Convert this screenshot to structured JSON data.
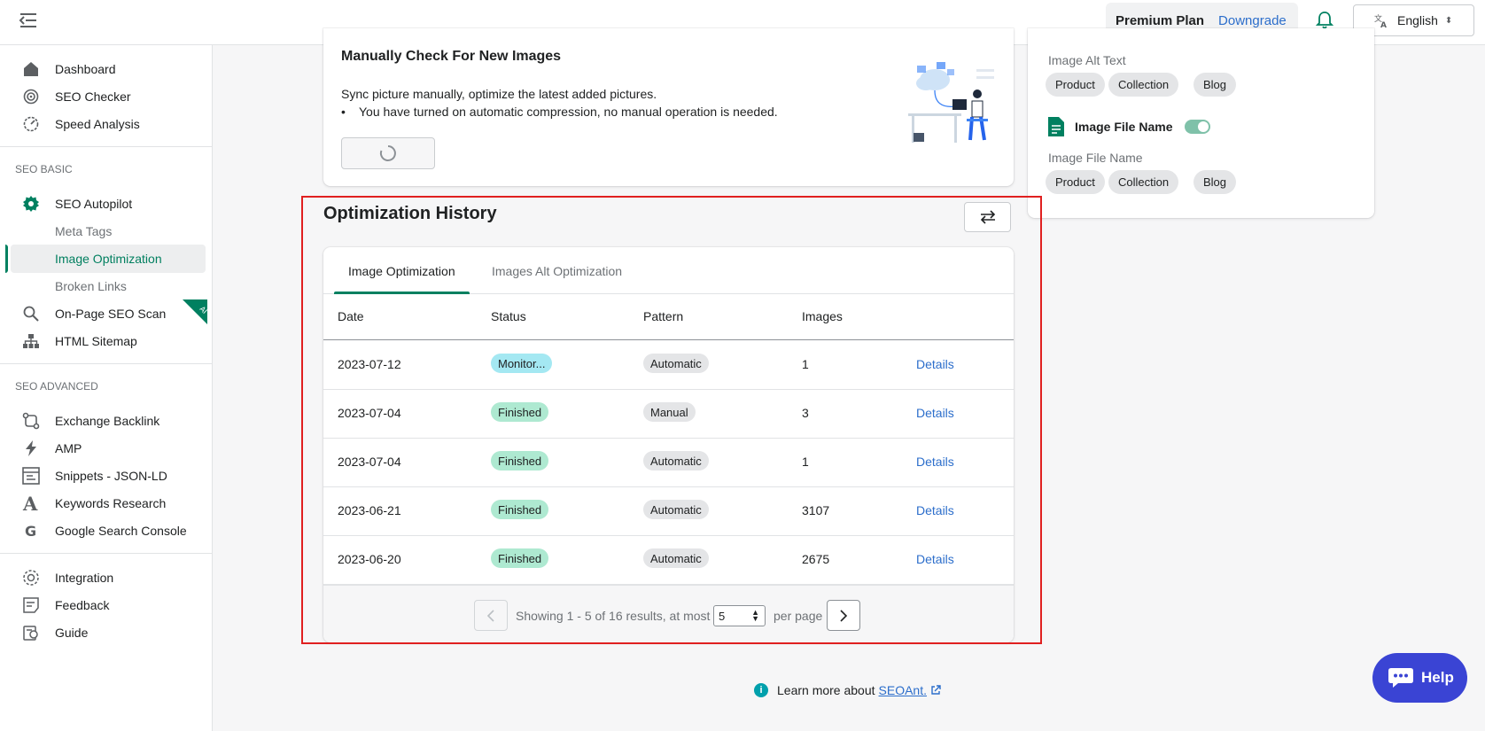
{
  "topbar": {
    "plan_name": "Premium Plan",
    "plan_action": "Downgrade",
    "language": "English"
  },
  "sidebar": {
    "main_items": [
      {
        "label": "Dashboard",
        "icon": "home-icon"
      },
      {
        "label": "SEO Checker",
        "icon": "target-icon"
      },
      {
        "label": "Speed Analysis",
        "icon": "gauge-icon"
      }
    ],
    "seo_basic_title": "SEO BASIC",
    "seo_basic_items": [
      {
        "label": "SEO Autopilot",
        "icon": "gear-icon"
      },
      {
        "label": "Meta Tags"
      },
      {
        "label": "Image Optimization",
        "active": true
      },
      {
        "label": "Broken Links"
      },
      {
        "label": "On-Page SEO Scan",
        "icon": "search-icon",
        "badge": "AI"
      },
      {
        "label": "HTML Sitemap",
        "icon": "sitemap-icon"
      }
    ],
    "seo_advanced_title": "SEO ADVANCED",
    "seo_advanced_items": [
      {
        "label": "Exchange Backlink",
        "icon": "exchange-icon"
      },
      {
        "label": "AMP",
        "icon": "lightning-icon"
      },
      {
        "label": "Snippets - JSON-LD",
        "icon": "snippet-icon"
      },
      {
        "label": "Keywords Research",
        "icon": "letter-a-icon"
      },
      {
        "label": "Google Search Console",
        "icon": "google-icon"
      }
    ],
    "bottom_items": [
      {
        "label": "Integration",
        "icon": "integration-icon"
      },
      {
        "label": "Feedback",
        "icon": "feedback-icon"
      },
      {
        "label": "Guide",
        "icon": "guide-icon"
      }
    ]
  },
  "check_card": {
    "title": "Manually Check For New Images",
    "description": "Sync picture manually, optimize the latest added pictures.",
    "bullet": "You have turned on automatic compression, no manual operation is needed."
  },
  "right_card": {
    "alt_text_label": "Image Alt Text",
    "alt_text_chips": [
      "Product",
      "Collection",
      "Blog"
    ],
    "file_name_toggle_label": "Image File Name",
    "file_name_toggle_on": true,
    "file_name_label": "Image File Name",
    "file_name_chips": [
      "Product",
      "Collection",
      "Blog"
    ]
  },
  "history": {
    "title": "Optimization History",
    "tabs": [
      "Image Optimization",
      "Images Alt Optimization"
    ],
    "active_tab": 0,
    "columns": [
      "Date",
      "Status",
      "Pattern",
      "Images"
    ],
    "rows": [
      {
        "date": "2023-07-12",
        "status": "Monitor...",
        "status_color": "#a4e8f2",
        "pattern": "Automatic",
        "images": "1",
        "action": "Details"
      },
      {
        "date": "2023-07-04",
        "status": "Finished",
        "status_color": "#aee9d1",
        "pattern": "Manual",
        "images": "3",
        "action": "Details"
      },
      {
        "date": "2023-07-04",
        "status": "Finished",
        "status_color": "#aee9d1",
        "pattern": "Automatic",
        "images": "1",
        "action": "Details"
      },
      {
        "date": "2023-06-21",
        "status": "Finished",
        "status_color": "#aee9d1",
        "pattern": "Automatic",
        "images": "3107",
        "action": "Details"
      },
      {
        "date": "2023-06-20",
        "status": "Finished",
        "status_color": "#aee9d1",
        "pattern": "Automatic",
        "images": "2675",
        "action": "Details"
      }
    ],
    "pager": {
      "showing_text": "Showing 1 - 5 of 16 results, at most",
      "per_page_value": "5",
      "per_page_suffix": "per page"
    }
  },
  "footer": {
    "learn_text": "Learn more about",
    "learn_link": "SEOAnt."
  },
  "help": {
    "label": "Help"
  },
  "colors": {
    "brand_green": "#008060",
    "link_blue": "#2c6ecb",
    "help_button": "#3a44d4",
    "highlight_border": "#e02020"
  }
}
